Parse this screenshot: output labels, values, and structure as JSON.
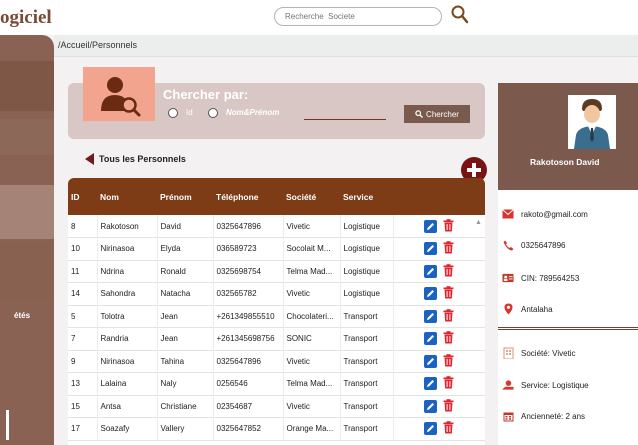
{
  "app": {
    "title": "ogiciel"
  },
  "search": {
    "placeholder": "Recherche  Societe"
  },
  "sidebar": {
    "label": "étés"
  },
  "breadcrumb": "/Accueil/Personnels",
  "search_panel": {
    "title": "Chercher par:",
    "option_id": "Id",
    "option_name": "Nom&Prénom",
    "button": "Chercher"
  },
  "list": {
    "link": "Tous les Personnels"
  },
  "table": {
    "headers": [
      "ID",
      "Nom",
      "Prénom",
      "Téléphone",
      "Société",
      "Service"
    ],
    "rows": [
      [
        "8",
        "Rakotoson",
        "David",
        "0325647896",
        "Vivetic",
        "Logistique"
      ],
      [
        "10",
        "Nirinasoa",
        "Elyda",
        "036589723",
        "Socolait M...",
        "Logistique"
      ],
      [
        "11",
        "Ndrina",
        "Ronald",
        "0325698754",
        "Telma Mad...",
        "Logistique"
      ],
      [
        "14",
        "Sahondra",
        "Natacha",
        "032565782",
        "Vivetic",
        "Logistique"
      ],
      [
        "5",
        "Tolotra",
        "Jean",
        "+261349855510",
        "Chocolateri...",
        "Transport"
      ],
      [
        "7",
        "Randria",
        "Jean",
        "+261345698756",
        "SONIC",
        "Transport"
      ],
      [
        "9",
        "Nirinasoa",
        "Tahina",
        "0325647896",
        "Vivetic",
        "Transport"
      ],
      [
        "13",
        "Lalaina",
        "Naly",
        "0256546",
        "Telma Mad...",
        "Transport"
      ],
      [
        "15",
        "Antsa",
        "Christiane",
        "02354687",
        "Vivetic",
        "Transport"
      ],
      [
        "17",
        "Soazafy",
        "Vallery",
        "0325647852",
        "Orange Ma...",
        "Transport"
      ]
    ]
  },
  "card": {
    "name": "Rakotoson  David",
    "email": "rakoto@gmail.com",
    "phone": "0325647896",
    "cin": "CIN: 789564253",
    "location": "Antalaha",
    "societe": "Société: Vivetic",
    "service": "Service: Logistique",
    "anciennete": "Ancienneté: 2  ans"
  },
  "colors": {
    "accent": "#7d3b16",
    "sidebar": "#8a6253",
    "panel": "#d8c7c4",
    "edit": "#1a63c2",
    "delete": "#e0242f"
  }
}
